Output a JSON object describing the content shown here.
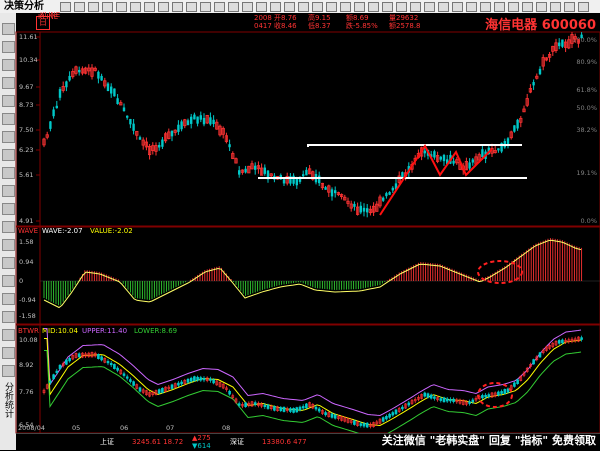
{
  "app_title": "决策分析",
  "logo_char": "日",
  "header": {
    "kline_label": "KLINE",
    "date_line1": "2008 开8.76",
    "date_line2": "0417 收8.46",
    "high": "高9.15",
    "low": "低8.37",
    "amt": "额8.69",
    "chg": "跌-5.85%",
    "vol": "量29632",
    "turn": "额2578.8",
    "stock_name": "海信电器",
    "stock_code": "600060"
  },
  "kline": {
    "y_ticks": [
      "11.61",
      "10.34",
      "9.67",
      "8.73",
      "7.50",
      "6.23",
      "5.61",
      "4.91"
    ],
    "right_labels": [
      "100.0%",
      "80.9%",
      "61.8%",
      "50.0%",
      "38.2%",
      "19.1%",
      "0.0%"
    ],
    "cursor_price": "11.61"
  },
  "wave": {
    "label": "WAVE",
    "wave_text": "WAVE:-2.07",
    "value_text": "VALUE:-2.02",
    "y_ticks": [
      "1.58",
      "0.94",
      "0",
      "-0.94",
      "-1.58"
    ]
  },
  "btwr": {
    "label": "BTWR",
    "mid_text": "MID:10.04",
    "upper_text": "UPPER:11.40",
    "lower_text": "LOWER:8.69",
    "y_ticks": [
      "10.08",
      "8.92",
      "7.76",
      "6.54"
    ],
    "x_labels": [
      "2008/04",
      "05",
      "06",
      "07",
      "08"
    ]
  },
  "bottom": {
    "index1": "上证",
    "index1_vals": "3245.61  18.72",
    "index2_up": "▲275",
    "index2_down": "▼614",
    "index3": "深证",
    "index3_vals": "13380.6  477",
    "watermark": "关注微信 \"老韩实盘\" 回复 \"指标\" 免费领取"
  },
  "colors": {
    "up": "#ff3333",
    "down": "#00c8c8",
    "wave_line": "#ffff66",
    "mid": "#ffff00",
    "upper": "#cc66ff",
    "lower": "#33cc33",
    "annot": "#ff2020"
  }
}
